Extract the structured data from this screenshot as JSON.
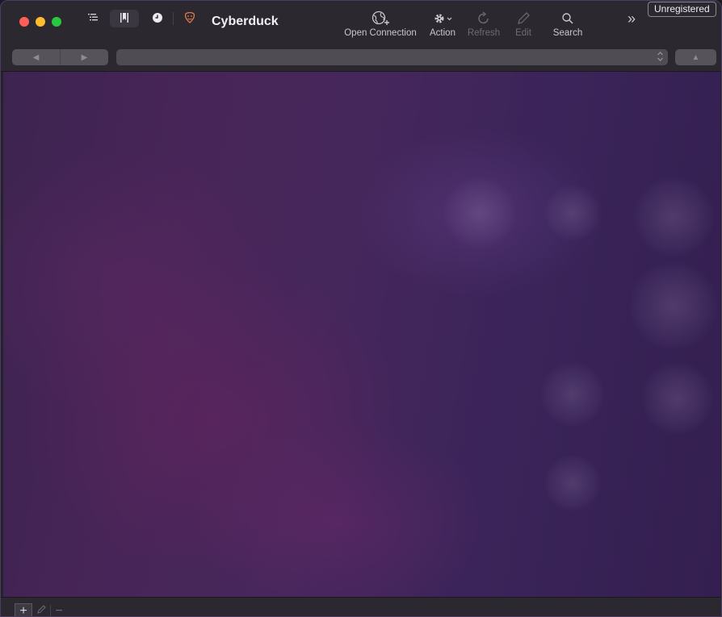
{
  "window": {
    "title": "Cyberduck",
    "badge": "Unregistered"
  },
  "view_toggles": [
    {
      "icon": "outline-view-icon",
      "active": false
    },
    {
      "icon": "bookmarks-icon",
      "active": true
    },
    {
      "icon": "history-icon",
      "active": false
    },
    {
      "icon": "bonjour-icon",
      "active": false
    }
  ],
  "toolbar": {
    "open_connection": "Open Connection",
    "action": "Action",
    "refresh": "Refresh",
    "edit": "Edit",
    "search": "Search",
    "overflow_glyph": "»"
  },
  "pathbar": {
    "back_glyph": "◀",
    "forward_glyph": "▶",
    "path_value": "",
    "up_glyph": "▲"
  },
  "bottombar": {
    "add_glyph": "+",
    "remove_glyph": "−"
  },
  "colors": {
    "close": "#fe5f57",
    "minimize": "#febc2e",
    "zoom": "#28c840",
    "content_bg": "#46275c"
  }
}
